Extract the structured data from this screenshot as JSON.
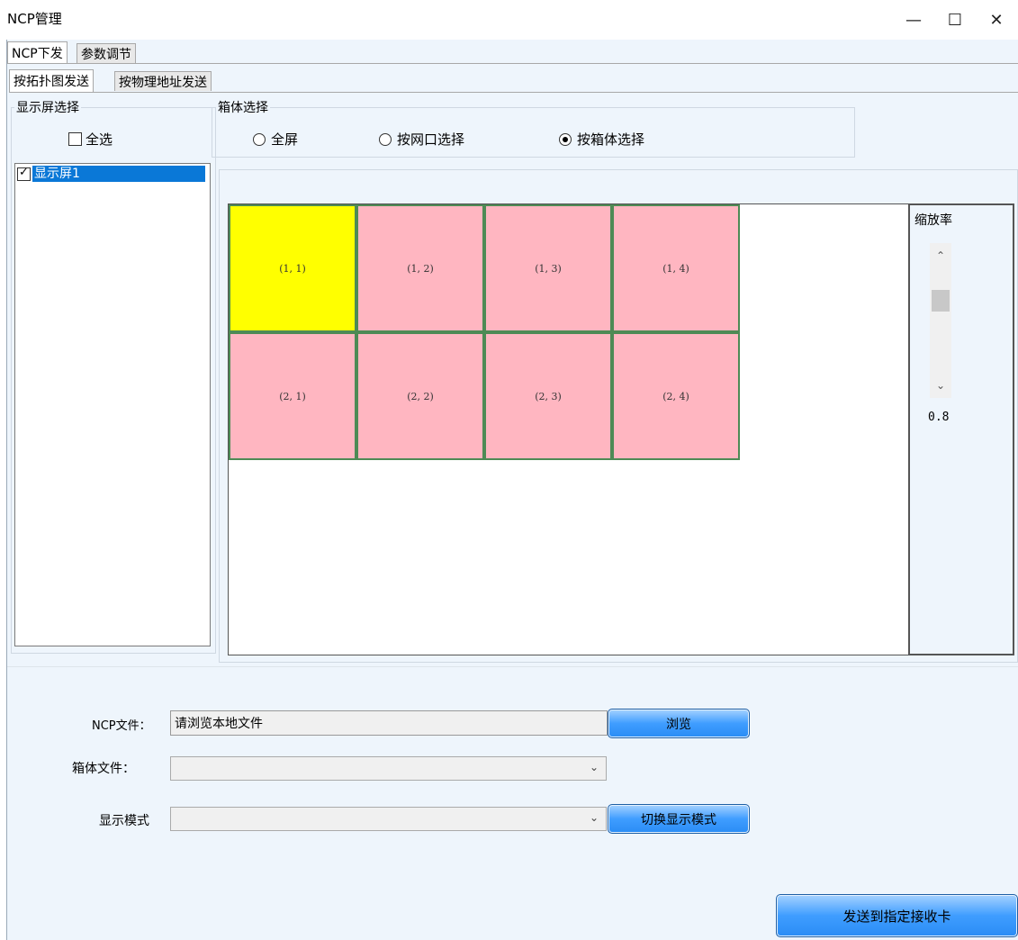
{
  "window": {
    "title": "NCP管理",
    "minimize": "—",
    "maximize": "☐",
    "close": "✕"
  },
  "tabs_top": [
    {
      "label": "NCP下发",
      "active": true
    },
    {
      "label": "参数调节",
      "active": false
    }
  ],
  "tabs_sub": [
    {
      "label": "按拓扑图发送",
      "active": true
    },
    {
      "label": "按物理地址发送",
      "active": false
    }
  ],
  "screen_group": {
    "legend": "显示屏选择",
    "select_all_label": "全选",
    "select_all_checked": false,
    "items": [
      {
        "label": "显示屏1",
        "checked": true,
        "selected": true
      }
    ]
  },
  "box_group": {
    "legend": "箱体选择",
    "options": [
      {
        "label": "全屏",
        "selected": false
      },
      {
        "label": "按网口选择",
        "selected": false
      },
      {
        "label": "按箱体选择",
        "selected": true
      }
    ]
  },
  "grid": {
    "rows": [
      [
        {
          "label": "(1, 1)",
          "selected": true
        },
        {
          "label": "(1, 2)",
          "selected": false
        },
        {
          "label": "(1, 3)",
          "selected": false
        },
        {
          "label": "(1, 4)",
          "selected": false
        }
      ],
      [
        {
          "label": "(2, 1)",
          "selected": false
        },
        {
          "label": "(2, 2)",
          "selected": false
        },
        {
          "label": "(2, 3)",
          "selected": false
        },
        {
          "label": "(2, 4)",
          "selected": false
        }
      ]
    ],
    "colors": {
      "selected": "#ffff00",
      "normal": "#ffb6c1",
      "border": "#4e8a55"
    }
  },
  "zoom": {
    "title": "缩放率",
    "value": "0.8",
    "up_icon": "chevron-up-icon",
    "down_icon": "chevron-down-icon"
  },
  "form": {
    "ncp_label": "NCP文件：",
    "ncp_value": "请浏览本地文件",
    "browse_label": "浏览",
    "boxfile_label": "箱体文件：",
    "boxfile_value": "",
    "mode_label": "显示模式",
    "mode_value": "",
    "switch_label": "切换显示模式",
    "send_label": "发送到指定接收卡"
  }
}
